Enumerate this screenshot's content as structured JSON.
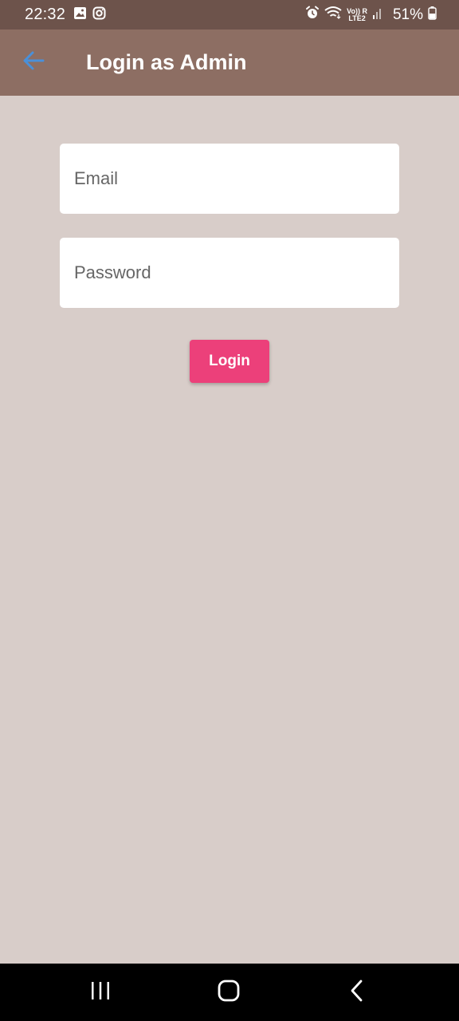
{
  "status_bar": {
    "time": "22:32",
    "network_top": "Vo)) R",
    "network_bottom": "LTE2",
    "battery": "51%",
    "icons": [
      "gallery-icon",
      "instagram-icon",
      "alarm-icon",
      "wifi-icon",
      "signal-icon",
      "battery-icon"
    ]
  },
  "app_bar": {
    "title": "Login as Admin",
    "back_icon": "arrow-back-icon",
    "background": "#8d6e63",
    "back_icon_color": "#4a90d9"
  },
  "form": {
    "email": {
      "placeholder": "Email",
      "value": ""
    },
    "password": {
      "placeholder": "Password",
      "value": ""
    },
    "login_button": {
      "label": "Login",
      "color": "#ec407a"
    }
  },
  "nav_bar": {
    "buttons": [
      "recent-apps-icon",
      "home-icon",
      "back-nav-icon"
    ]
  },
  "colors": {
    "status_bar": "#6d534b",
    "page_background": "#d8cdc9",
    "nav_bar": "#000000"
  }
}
